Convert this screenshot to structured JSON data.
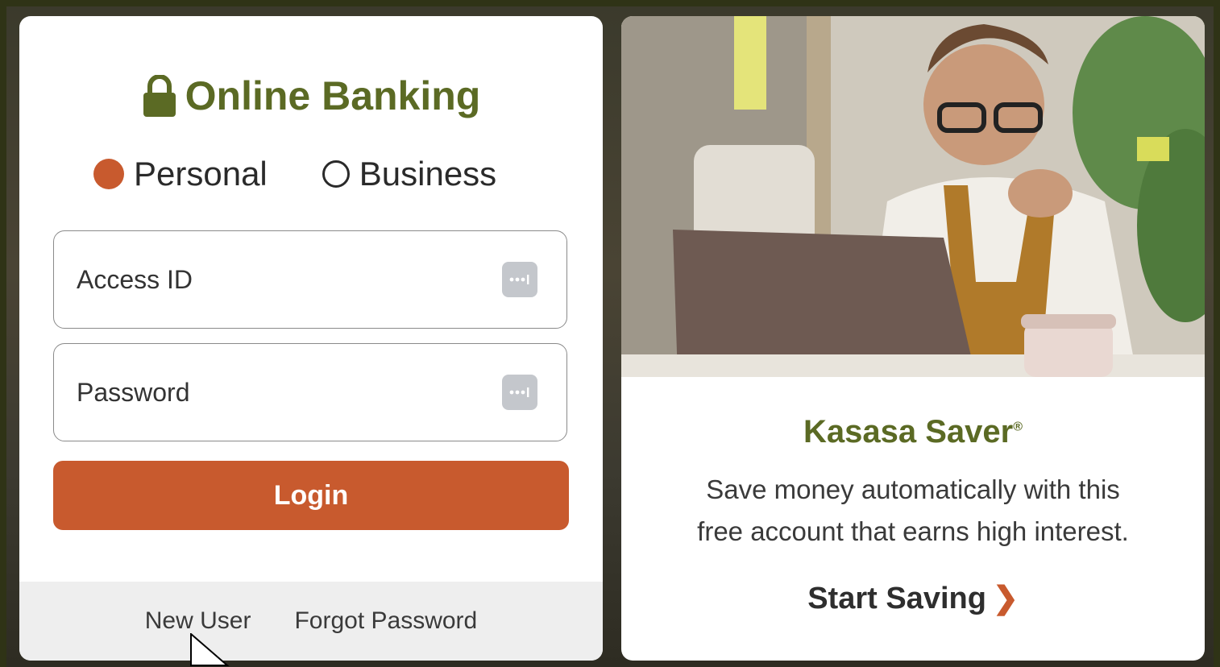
{
  "login": {
    "title": "Online Banking",
    "radio_personal": "Personal",
    "radio_business": "Business",
    "access_id_placeholder": "Access ID",
    "password_placeholder": "Password",
    "login_label": "Login",
    "new_user": "New User",
    "forgot_password": "Forgot Password"
  },
  "promo": {
    "title": "Kasasa Saver",
    "trademark": "®",
    "desc_line1": "Save money automatically with this",
    "desc_line2": "free account that earns high interest.",
    "cta": "Start Saving",
    "cta_chevron": "❯"
  },
  "icons": {
    "lock": "lock-icon",
    "password_manager": "password-manager-icon"
  },
  "colors": {
    "brand_green": "#5b6a24",
    "accent_orange": "#c85a2e"
  }
}
